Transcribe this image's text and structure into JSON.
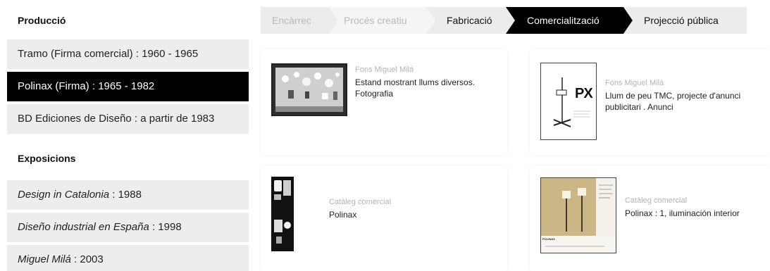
{
  "sidebar": {
    "production_title": "Producció",
    "production_items": [
      {
        "name": "Tramo (Firma comercial)",
        "suffix": " : 1960 - 1965"
      },
      {
        "name": "Polinax (Firma)",
        "suffix": " : 1965 - 1982"
      },
      {
        "name": "BD Ediciones de Diseño",
        "suffix": " : a partir de 1983"
      }
    ],
    "exhibitions_title": "Exposicions",
    "exhibition_items": [
      {
        "name": "Design in Catalonia",
        "suffix": " : 1988"
      },
      {
        "name": "Diseño industrial en España",
        "suffix": " : 1998"
      },
      {
        "name": "Miguel Milá",
        "suffix": " : 2003"
      }
    ]
  },
  "steps": [
    "Encàrrec",
    "Procés creatiu",
    "Fabricació",
    "Comercialització",
    "Projecció pública"
  ],
  "cards": [
    {
      "source": "Fons Miguel Milá",
      "desc1": "Estand mostrant llums diversos.",
      "desc2": "Fotografia"
    },
    {
      "source": "Fons Miguel Milá",
      "desc1": "Llum de peu TMC, projecte d'anunci",
      "desc2": "publicitari . Anunci"
    },
    {
      "source": "Catàleg comercial",
      "desc1": "Polinax",
      "desc2": ""
    },
    {
      "source": "Catàleg comercial",
      "desc1": "Polinax : 1, iluminación interior",
      "desc2": ""
    }
  ],
  "thumb_text": {
    "px_logo": "PX",
    "catalog_header": "POLINAX"
  }
}
